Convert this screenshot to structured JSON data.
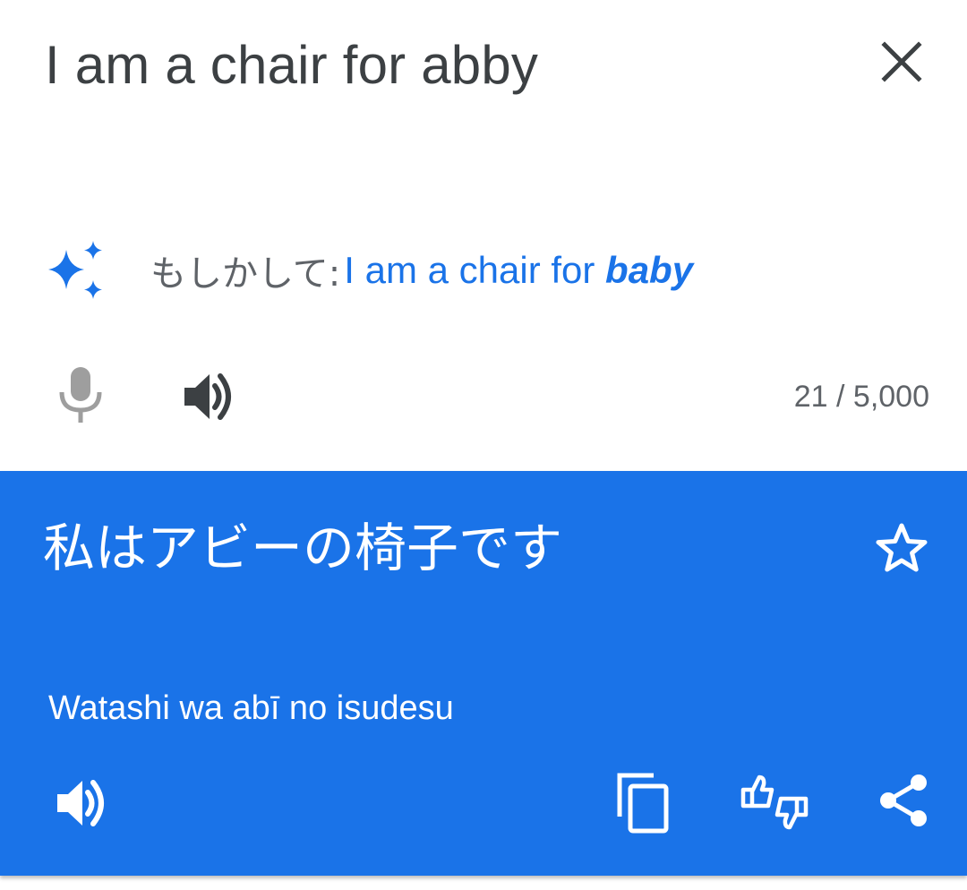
{
  "source": {
    "text": "I am a chair for abby",
    "clear_icon": "close-icon",
    "suggestion": {
      "icon": "sparkle-icon",
      "prefix": "もしかして: ",
      "link_plain": "I am a chair for ",
      "link_emphasis": "baby"
    },
    "mic_icon": "mic-icon",
    "speak_icon": "volume-icon",
    "char_count": "21 / 5,000"
  },
  "target": {
    "text": "私はアビーの椅子です",
    "star_icon": "star-outline-icon",
    "romanization": "Watashi wa abī no isudesu",
    "actions": [
      {
        "icon": "volume-icon",
        "name": "listen"
      },
      {
        "icon": "copy-icon",
        "name": "copy"
      },
      {
        "icon": "thumbs-up-down-icon",
        "name": "rate"
      },
      {
        "icon": "share-icon",
        "name": "share"
      }
    ]
  },
  "colors": {
    "accent": "#1a73e8",
    "source_text": "#3c4043",
    "secondary_text": "#5f6368",
    "disabled_icon": "#9e9e9e",
    "on_accent": "#ffffff"
  }
}
